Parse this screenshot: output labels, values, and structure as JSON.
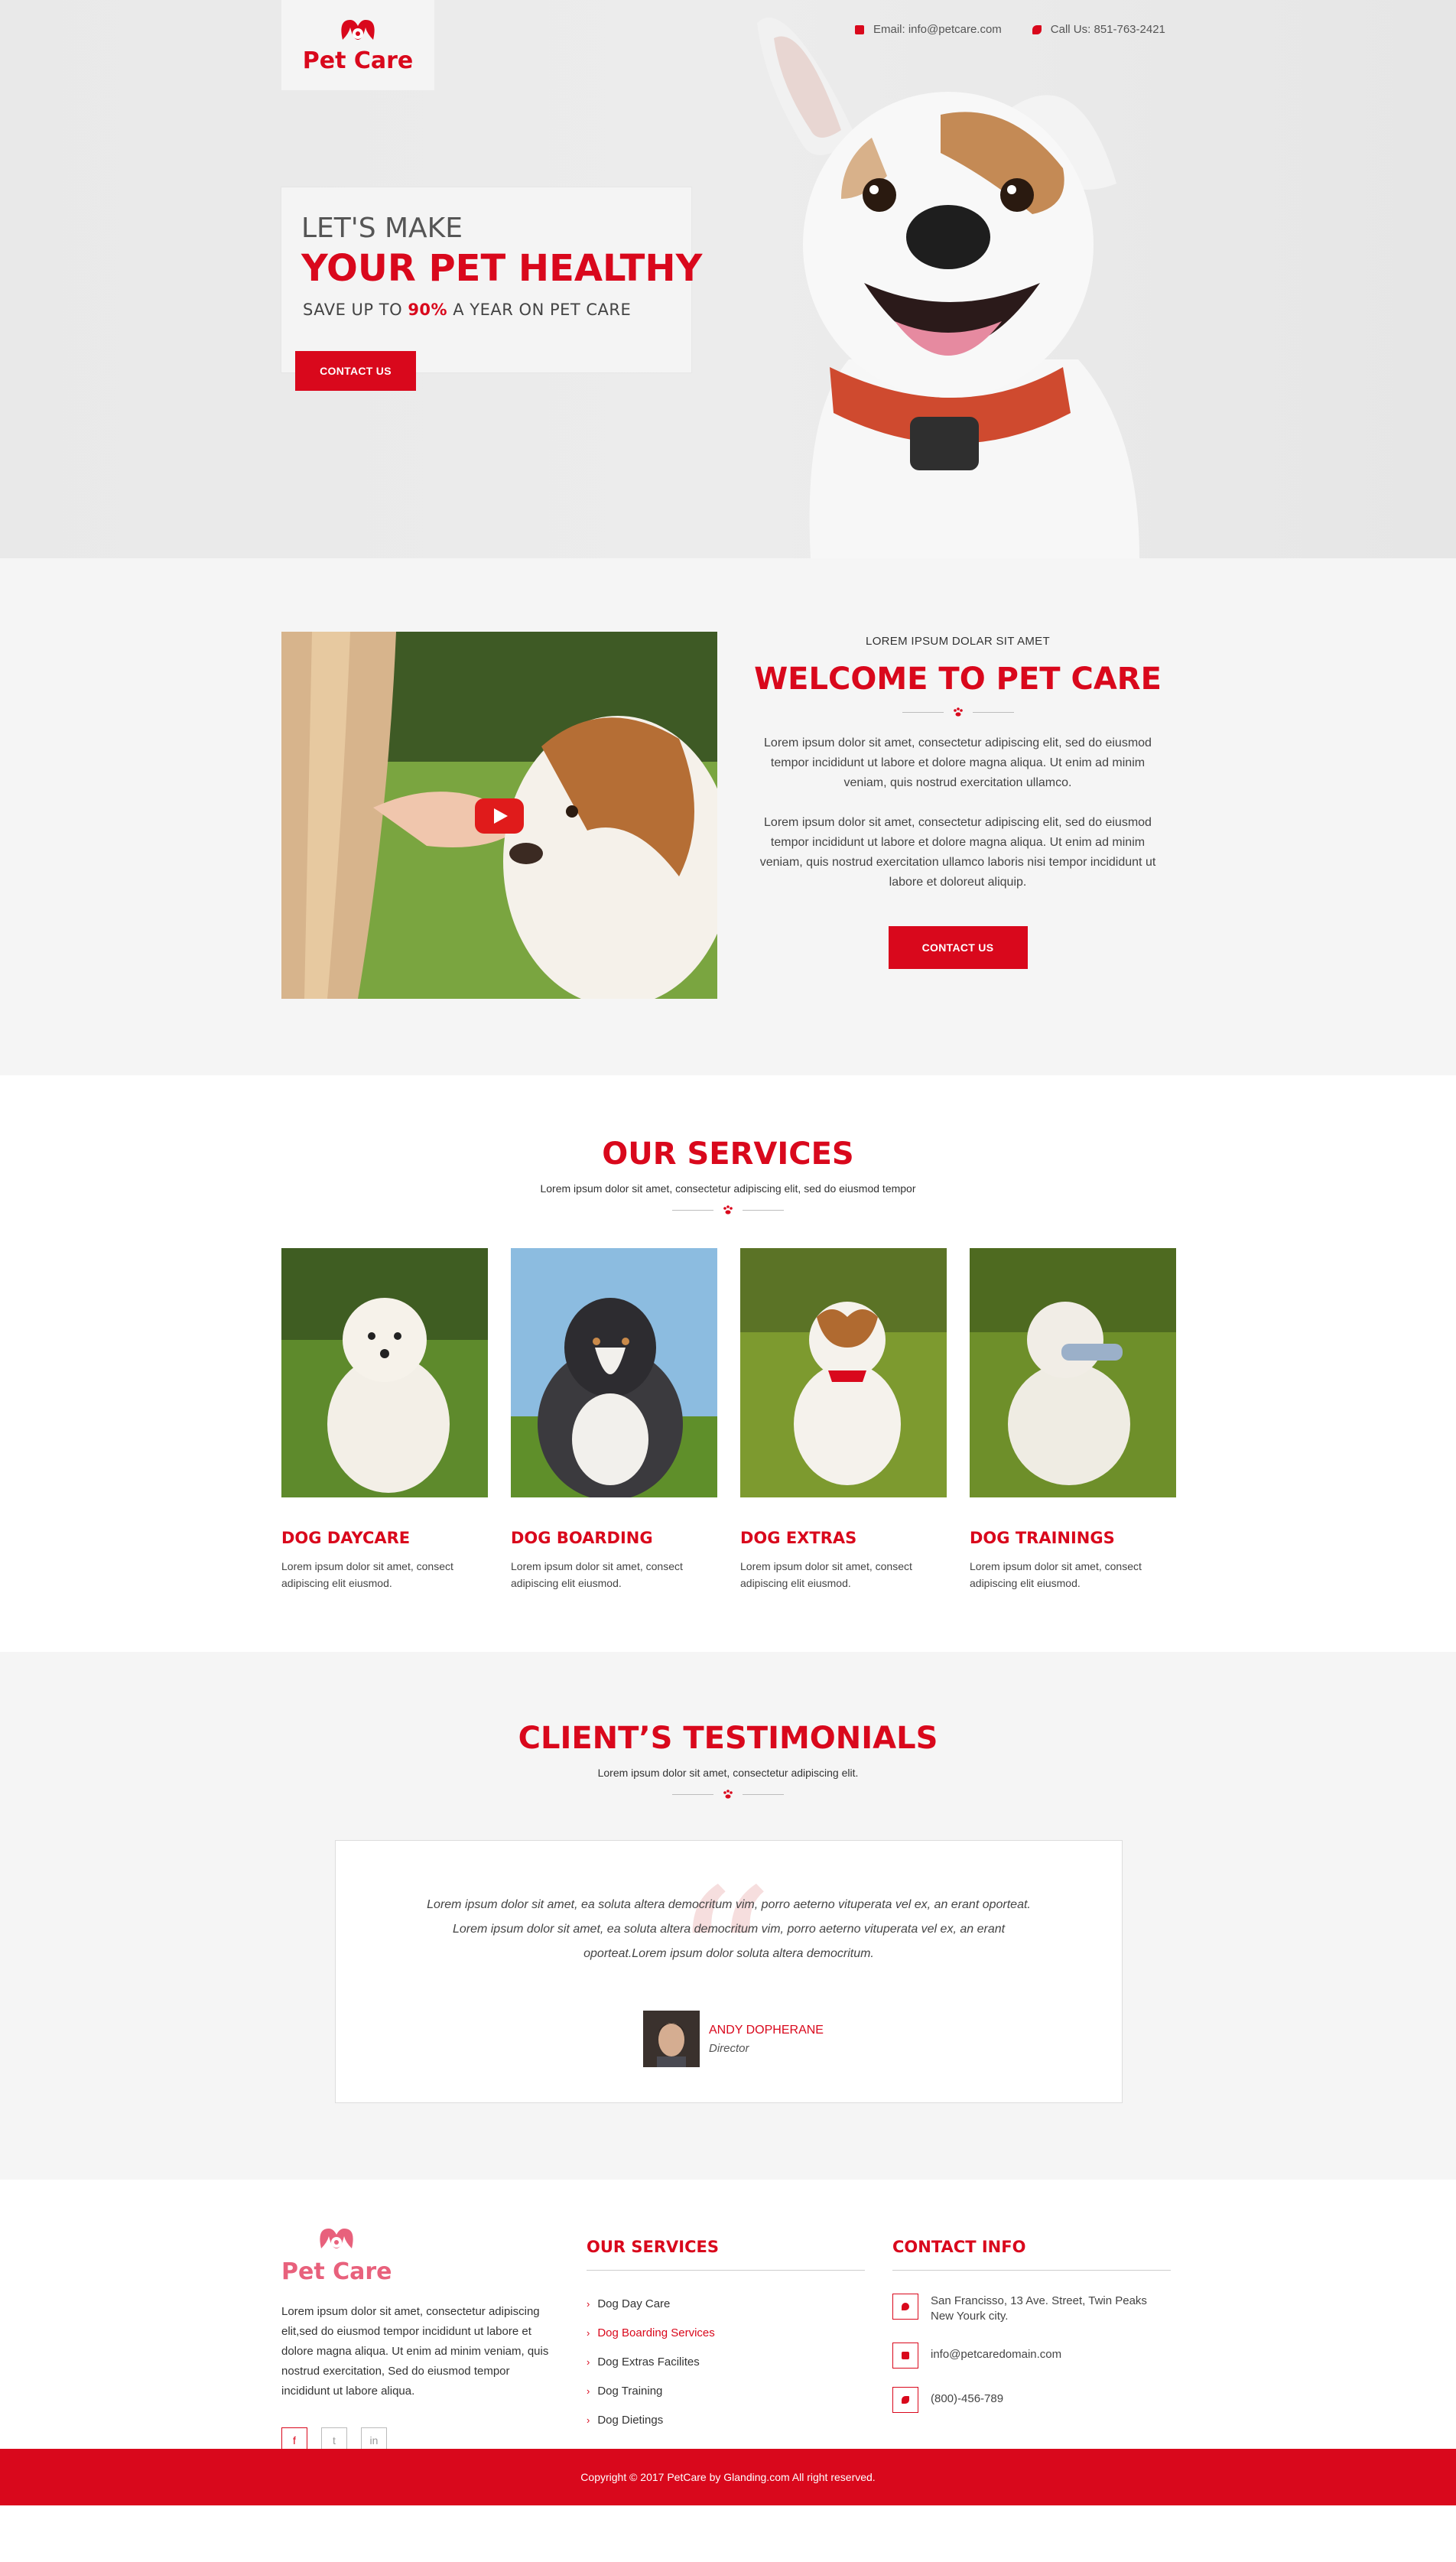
{
  "brand": {
    "name": "Pet Care",
    "primary_color": "#d9081c"
  },
  "topbar": {
    "email": "Email: info@petcare.com",
    "phone": "Call Us: 851-763-2421",
    "email_icon": "envelope-icon",
    "phone_icon": "phone-icon"
  },
  "hero": {
    "kicker": "LET'S MAKE",
    "title": "YOUR PET HEALTHY",
    "sub_pre": "SAVE UP TO",
    "sub_highlight": "90%",
    "sub_post": "A YEAR ON PET CARE",
    "button": "CONTACT US"
  },
  "welcome": {
    "kicker": "LOREM IPSUM DOLAR SIT AMET",
    "title": "WELCOME TO PET CARE",
    "para1": "Lorem ipsum dolor sit amet, consectetur adipiscing elit, sed do eiusmod tempor incididunt ut labore et dolore magna aliqua. Ut enim ad minim veniam, quis nostrud exercitation ullamco.",
    "para2": "Lorem ipsum dolor sit amet, consectetur adipiscing elit, sed do eiusmod tempor incididunt ut labore et dolore magna aliqua. Ut enim ad minim veniam, quis nostrud exercitation ullamco laboris nisi tempor incididunt ut labore et doloreut aliquip.",
    "button": "CONTACT US",
    "video_icon": "play-icon"
  },
  "services": {
    "title": "OUR SERVICES",
    "subtitle": "Lorem ipsum dolor sit amet, consectetur adipiscing elit, sed do eiusmod tempor",
    "items": [
      {
        "title": "DOG DAYCARE",
        "desc": "Lorem ipsum dolor sit amet, consect adipiscing elit eiusmod."
      },
      {
        "title": "DOG BOARDING",
        "desc": "Lorem ipsum dolor sit amet, consect adipiscing elit eiusmod."
      },
      {
        "title": "DOG EXTRAS",
        "desc": "Lorem ipsum dolor sit amet, consect adipiscing elit eiusmod."
      },
      {
        "title": "DOG TRAININGS",
        "desc": "Lorem ipsum dolor sit amet, consect adipiscing elit eiusmod."
      }
    ]
  },
  "testimonials": {
    "title": "CLIENT’S TESTIMONIALS",
    "subtitle": "Lorem ipsum dolor sit amet, consectetur adipiscing elit.",
    "quote": "Lorem ipsum dolor sit amet, ea soluta altera democritum vim, porro aeterno vituperata vel ex, an erant oporteat. Lorem ipsum dolor sit amet, ea soluta altera democritum vim, porro aeterno vituperata vel ex, an erant oporteat.Lorem ipsum dolor soluta altera democritum.",
    "author_name": "ANDY DOPHERANE",
    "author_role": "Director"
  },
  "footer": {
    "logo": "Pet Care",
    "description": "Lorem ipsum dolor sit amet, consectetur adipiscing elit,sed do eiusmod tempor incididunt ut labore et dolore magna aliqua. Ut enim ad minim veniam, quis nostrud exercitation, Sed do eiusmod tempor incididunt ut labore aliqua.",
    "socials": [
      "f",
      "t",
      "in"
    ],
    "services_title": "OUR SERVICES",
    "services_links": [
      "Dog Day Care",
      "Dog Boarding Services",
      "Dog Extras Facilites",
      "Dog Training",
      "Dog Dietings"
    ],
    "contact_title": "CONTACT INFO",
    "address": "San Francisso, 13 Ave. Street, Twin Peaks New Yourk city.",
    "email": "info@petcaredomain.com",
    "phone": "(800)-456-789",
    "copyright": "Copyright ©  2017 PetCare by Glanding.com All right reserved."
  }
}
